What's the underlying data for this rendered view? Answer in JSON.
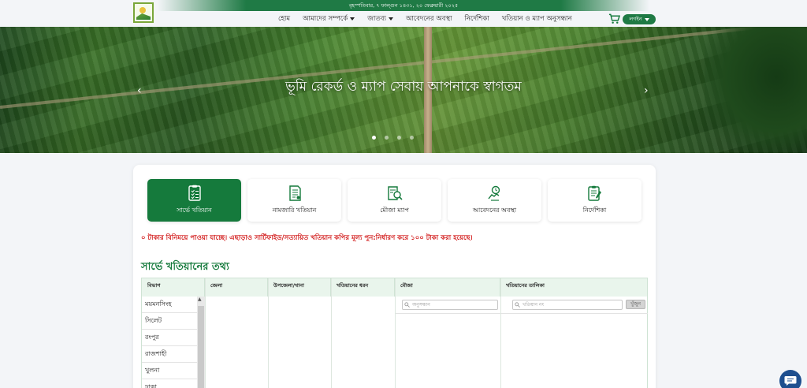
{
  "datebar": {
    "text": "বৃহস্পতিবার, ৭ ফাল্গুন ১৪৩১, ২০ ফেব্রুয়ারী ২০২৫"
  },
  "nav": {
    "items": [
      {
        "label": "হোম",
        "dropdown": false
      },
      {
        "label": "আমাদের সম্পর্কে",
        "dropdown": true
      },
      {
        "label": "জাতব্য",
        "dropdown": true
      },
      {
        "label": "আবেদনের অবস্থা",
        "dropdown": false
      },
      {
        "label": "নির্দেশিকা",
        "dropdown": false
      },
      {
        "label": "খতিয়ান ও ম্যাপ অনুসন্ধান",
        "dropdown": false
      }
    ],
    "login_label": "লগইন",
    "cart_icon": "cart-icon"
  },
  "hero": {
    "title": "ভূমি রেকর্ড ও ম্যাপ সেবায় আপনাকে স্বাগতম",
    "prev": "‹",
    "next": "›",
    "slide_count": 4,
    "active_slide": 1
  },
  "tabs": [
    {
      "label": "সার্ভে খতিয়ান",
      "icon": "survey-doc-icon",
      "active": true
    },
    {
      "label": "নামজারি খতিয়ান",
      "icon": "mutation-doc-icon",
      "active": false
    },
    {
      "label": "মৌজা ম্যাপ",
      "icon": "map-search-icon",
      "active": false
    },
    {
      "label": "আবেদনের অবস্থা",
      "icon": "application-status-icon",
      "active": false
    },
    {
      "label": "নির্দেশিকা",
      "icon": "guideline-icon",
      "active": false
    }
  ],
  "notice": "০ টাকার বিনিময়ে পাওয়া যাচ্ছে। এছাড়াও সার্টিফাইড/সত্যায়িত খতিয়ান কপির মূল্য পুন:নির্ধারণ করে ১০০ টাকা করা হয়েছে।",
  "section_title": "সার্ভে খতিয়ানের তথ্য",
  "grid": {
    "columns": [
      "বিভাগ",
      "জেলা",
      "উপজেলা/থানা",
      "খতিয়ানের ধরন",
      "মৌজা",
      "খতিয়ানের তালিকা"
    ],
    "divisions": [
      "ময়মনসিংহ",
      "সিলেট",
      "রংপুর",
      "রাজশাহী",
      "খুলনা",
      "ঢাকা"
    ],
    "mouza_search_placeholder": "অনুসন্ধান",
    "khatian_search_placeholder": "খতিয়ান নং",
    "search_button": "খুঁজুন"
  },
  "colors": {
    "brand_green": "#157a3c",
    "notice_red": "#d32020",
    "chat_blue": "#1e4f8f"
  }
}
